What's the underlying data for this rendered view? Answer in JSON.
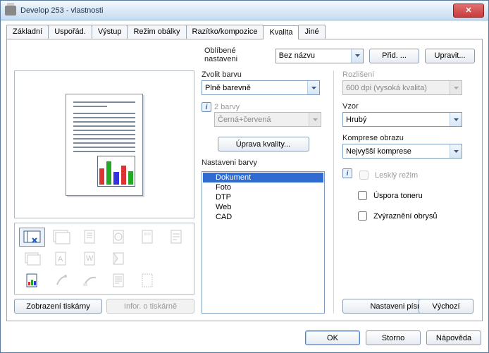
{
  "window": {
    "title": "Develop 253 - vlastnosti",
    "close_glyph": "✕"
  },
  "tabs": {
    "basic": "Základní",
    "layout": "Uspořád.",
    "output": "Výstup",
    "envelope": "Režim obálky",
    "stamp": "Razítko/kompozice",
    "quality": "Kvalita",
    "other": "Jiné"
  },
  "favorites": {
    "label": "Oblíbené nastaveni",
    "value": "Bez názvu",
    "add": "Přid. ...",
    "edit": "Upravit..."
  },
  "left": {
    "show_printer": "Zobrazení tiskárny",
    "printer_info": "Infor. o tiskárně"
  },
  "mid": {
    "color_label": "Zvolit barvu",
    "color_value": "Plně barevně",
    "two_colors_label": "2 barvy",
    "two_colors_value": "Černá+červená",
    "quality_adjust": "Úprava kvality...",
    "color_settings_label": "Nastaveni barvy",
    "items": [
      "Dokument",
      "Foto",
      "DTP",
      "Web",
      "CAD"
    ],
    "selected_index": 0
  },
  "right": {
    "resolution_label": "Rozlišení",
    "resolution_value": "600 dpi (vysoká kvalita)",
    "pattern_label": "Vzor",
    "pattern_value": "Hrubý",
    "compression_label": "Komprese obrazu",
    "compression_value": "Nejvyšší komprese",
    "glossy": "Lesklý režim",
    "toner_save": "Úspora toneru",
    "edge_enhance": "Zvýraznění obrysů",
    "font_settings": "Nastaveni písma...",
    "defaults": "Výchozí"
  },
  "footer": {
    "ok": "OK",
    "cancel": "Storno",
    "help": "Nápověda"
  }
}
